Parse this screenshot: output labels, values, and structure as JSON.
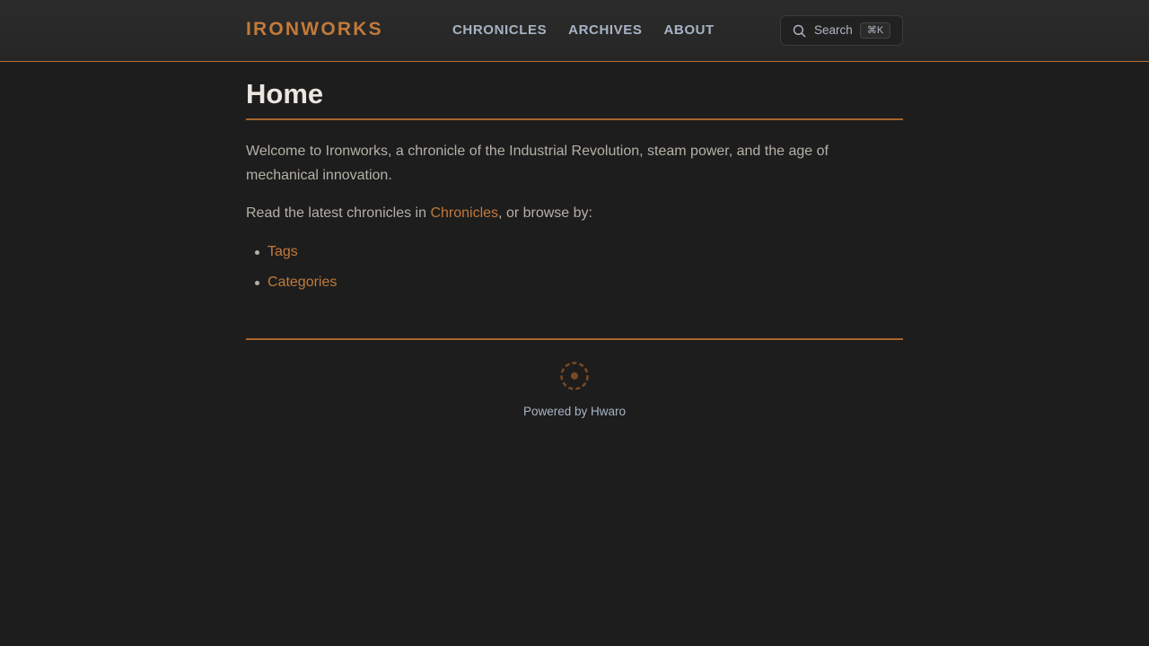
{
  "header": {
    "brand": "IRONWORKS",
    "nav": [
      {
        "label": "CHRONICLES"
      },
      {
        "label": "ARCHIVES"
      },
      {
        "label": "ABOUT"
      }
    ],
    "search": {
      "label": "Search",
      "shortcut": "⌘K",
      "icon": "search-icon"
    }
  },
  "main": {
    "title": "Home",
    "intro": "Welcome to Ironworks, a chronicle of the Industrial Revolution, steam power, and the age of mechanical innovation.",
    "browse_prefix": "Read the latest chronicles in ",
    "browse_link": "Chronicles",
    "browse_suffix": ", or browse by:",
    "links": [
      {
        "label": "Tags"
      },
      {
        "label": "Categories"
      }
    ]
  },
  "footer": {
    "icon": "gear-icon",
    "powered_by": "Powered by Hwaro"
  },
  "colors": {
    "background": "#1d1d1d",
    "accent": "#c17a3a",
    "nav_text": "#a7b3c4",
    "heading": "#ebe6df",
    "body_text": "#b5b0a8"
  }
}
